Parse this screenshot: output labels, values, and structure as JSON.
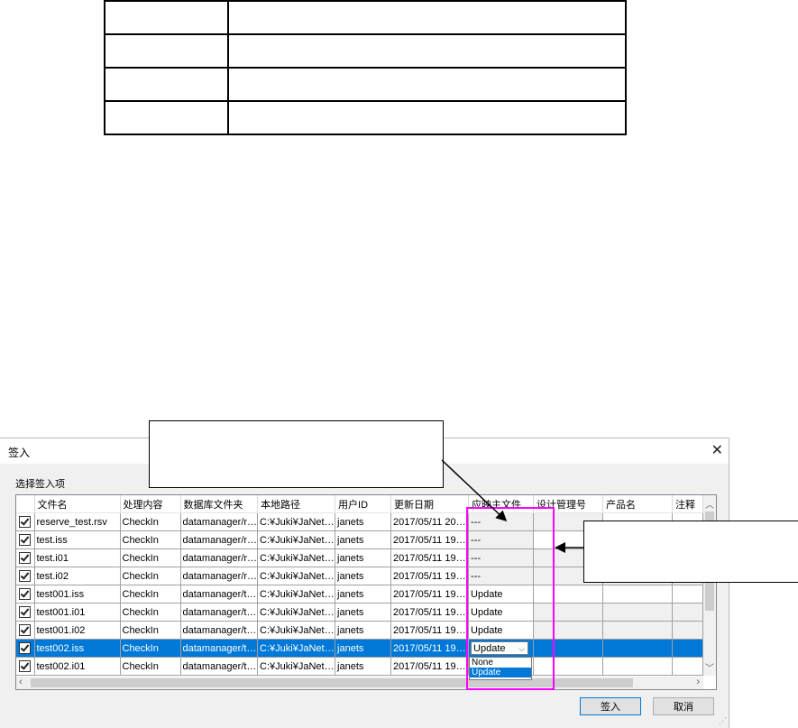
{
  "dialog": {
    "title": "签入",
    "close_glyph": "✕",
    "group_label": "选择签入项",
    "columns": [
      "",
      "文件名",
      "处理内容",
      "数据库文件夹",
      "本地路径",
      "用户ID",
      "更新日期",
      "应映主文件",
      "设计管理号",
      "产品名",
      "注释"
    ],
    "rows": [
      {
        "file": "reserve_test.rsv",
        "action": "CheckIn",
        "db_folder": "datamanager/r…",
        "local": "C:¥Juki¥JaNet…",
        "user": "janets",
        "date": "2017/05/11 20…",
        "master": "---"
      },
      {
        "file": "test.iss",
        "action": "CheckIn",
        "db_folder": "datamanager/r…",
        "local": "C:¥Juki¥JaNet…",
        "user": "janets",
        "date": "2017/05/11 19…",
        "master": "---"
      },
      {
        "file": "test.i01",
        "action": "CheckIn",
        "db_folder": "datamanager/r…",
        "local": "C:¥Juki¥JaNet…",
        "user": "janets",
        "date": "2017/05/11 19…",
        "master": "---"
      },
      {
        "file": "test.i02",
        "action": "CheckIn",
        "db_folder": "datamanager/r…",
        "local": "C:¥Juki¥JaNet…",
        "user": "janets",
        "date": "2017/05/11 19…",
        "master": "---"
      },
      {
        "file": "test001.iss",
        "action": "CheckIn",
        "db_folder": "datamanager/t…",
        "local": "C:¥Juki¥JaNet…",
        "user": "janets",
        "date": "2017/05/11 19…",
        "master": "Update"
      },
      {
        "file": "test001.i01",
        "action": "CheckIn",
        "db_folder": "datamanager/t…",
        "local": "C:¥Juki¥JaNet…",
        "user": "janets",
        "date": "2017/05/11 19…",
        "master": "Update"
      },
      {
        "file": "test001.i02",
        "action": "CheckIn",
        "db_folder": "datamanager/t…",
        "local": "C:¥Juki¥JaNet…",
        "user": "janets",
        "date": "2017/05/11 19…",
        "master": "Update"
      },
      {
        "file": "test002.iss",
        "action": "CheckIn",
        "db_folder": "datamanager/t…",
        "local": "C:¥Juki¥JaNet…",
        "user": "janets",
        "date": "2017/05/11 19…",
        "master": "Update"
      },
      {
        "file": "test002.i01",
        "action": "CheckIn",
        "db_folder": "datamanager/t…",
        "local": "C:¥Juki¥JaNet…",
        "user": "janets",
        "date": "2017/05/11 19…",
        "master": ""
      }
    ],
    "selected_row": "test002.iss",
    "dropdown_options": [
      "None",
      "Update"
    ],
    "dropdown_highlighted": "Update",
    "ok_label": "签入",
    "cancel_label": "取消"
  },
  "colors": {
    "selection": "#0078d7",
    "highlight_box": "#ff00ff"
  }
}
